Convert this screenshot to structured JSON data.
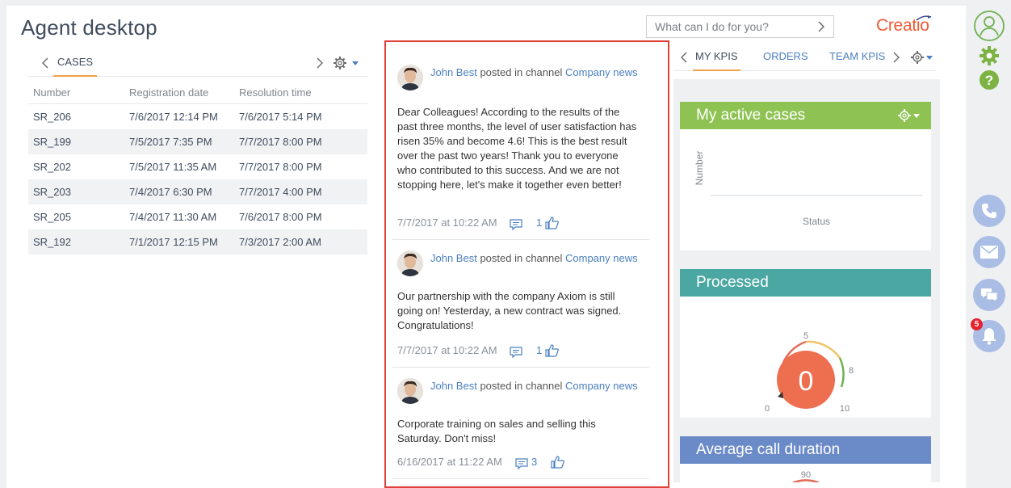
{
  "page": {
    "title": "Agent desktop"
  },
  "command": {
    "placeholder": "What can I do for you?"
  },
  "brand": {
    "logo_text": "Creatio",
    "color": "#ef5a35"
  },
  "cases": {
    "tab_label": "CASES",
    "columns": [
      "Number",
      "Registration date",
      "Resolution time"
    ],
    "rows": [
      {
        "number": "SR_206",
        "registered": "7/6/2017 12:14 PM",
        "resolution": "7/6/2017 5:14 PM"
      },
      {
        "number": "SR_199",
        "registered": "7/5/2017 7:35 PM",
        "resolution": "7/7/2017 8:00 PM"
      },
      {
        "number": "SR_202",
        "registered": "7/5/2017 11:35 AM",
        "resolution": "7/7/2017 8:00 PM"
      },
      {
        "number": "SR_203",
        "registered": "7/4/2017 6:30 PM",
        "resolution": "7/7/2017 4:00 PM"
      },
      {
        "number": "SR_205",
        "registered": "7/4/2017 11:30 AM",
        "resolution": "7/6/2017 8:00 PM"
      },
      {
        "number": "SR_192",
        "registered": "7/1/2017 12:15 PM",
        "resolution": "7/3/2017 2:00 AM"
      }
    ]
  },
  "feed": {
    "posts": [
      {
        "author": "John Best",
        "action": "posted in channel",
        "channel": "Company news",
        "text": "Dear Colleagues! According to the results of the past three months, the level of user satisfaction has risen 35% and become 4.6! This is the best result over the past two years! Thank you to everyone who contributed to this success. And we are not stopping here, let's make it together even better!",
        "date": "7/7/2017 at 10:22 AM",
        "comments": "",
        "likes": "1"
      },
      {
        "author": "John Best",
        "action": "posted in channel",
        "channel": "Company news",
        "text": "Our partnership with the company Axiom is still going on! Yesterday, a new contract was signed. Congratulations!",
        "date": "7/7/2017 at 10:22 AM",
        "comments": "",
        "likes": "1"
      },
      {
        "author": "John Best",
        "action": "posted in channel",
        "channel": "Company news",
        "text": "Corporate training on sales and selling this Saturday. Don't miss!",
        "date": "6/16/2017 at 11:22 AM",
        "comments": "3",
        "likes": ""
      }
    ]
  },
  "dashboard": {
    "tabs": [
      "MY KPIS",
      "ORDERS",
      "TEAM KPIS"
    ],
    "widgets": {
      "active_cases": {
        "title": "My active cases",
        "ylabel": "Number",
        "xlabel": "Status",
        "color": "#8ec353"
      },
      "processed": {
        "title": "Processed",
        "value": "0",
        "ticks": [
          "0",
          "5",
          "8",
          "10"
        ],
        "color": "#4aa7a1"
      },
      "avg_call": {
        "title": "Average call duration",
        "tick": "90",
        "color": "#6a8ac8"
      }
    }
  },
  "rail": {
    "notifications_count": "5"
  }
}
